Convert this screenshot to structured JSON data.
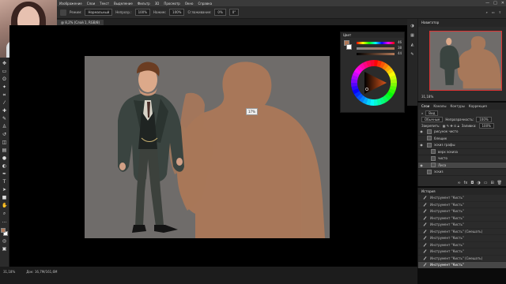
{
  "menubar": {
    "items": [
      "Изображение",
      "Слои",
      "Текст",
      "Выделение",
      "Фильтр",
      "3D",
      "Просмотр",
      "Окно",
      "Справка"
    ],
    "controls": [
      "—",
      "□",
      "✕"
    ]
  },
  "options": {
    "mode_label": "Режим:",
    "mode_value": "Нормальный",
    "opacity_label": "Непрозр.:",
    "opacity_value": "100%",
    "pressure_label": "Нажим:",
    "pressure_value": "100%",
    "smoothing_label": "Сглаживание:",
    "smoothing_value": "0%",
    "angle_value": "0°"
  },
  "document": {
    "tab_label": "@ 8,2% (Слой 1, RGB/8)",
    "cursor_tip": "17%"
  },
  "color_panel": {
    "title": "Цвет",
    "slider_values": [
      "46",
      "38",
      "44"
    ]
  },
  "navigator": {
    "title": "Навигатор",
    "zoom": "31,18%"
  },
  "layers": {
    "tabs": [
      "Слои",
      "Каналы",
      "Контуры",
      "Коррекция"
    ],
    "active_tab": "Слои",
    "filter_label": "Вид",
    "blend_mode": "Обычные",
    "opacity_label": "Непрозрачность:",
    "opacity_value": "100%",
    "lock_label": "Закрепить:",
    "fill_label": "Заливка:",
    "fill_value": "100%",
    "items": [
      {
        "name": "рисунок чисто",
        "visible": true,
        "selected": false,
        "indent": false
      },
      {
        "name": "блещик",
        "visible": false,
        "selected": false,
        "indent": false
      },
      {
        "name": "эскиз графы",
        "visible": true,
        "selected": false,
        "indent": false
      },
      {
        "name": "верх эскиза",
        "visible": false,
        "selected": false,
        "indent": true
      },
      {
        "name": "чисто",
        "visible": false,
        "selected": false,
        "indent": true
      },
      {
        "name": "Лиса",
        "visible": true,
        "selected": true,
        "indent": true
      },
      {
        "name": "эскиз",
        "visible": false,
        "selected": false,
        "indent": false
      }
    ]
  },
  "history": {
    "title": "История",
    "items": [
      "Инструмент \"Кисть\"",
      "Инструмент \"Кисть\"",
      "Инструмент \"Кисть\"",
      "Инструмент \"Кисть\"",
      "Инструмент \"Кисть\"",
      "Инструмент \"Кисть\" (Смешать)",
      "Инструмент \"Кисть\"",
      "Инструмент \"Кисть\"",
      "Инструмент \"Кисть\"",
      "Инструмент \"Кисть\" (Смешать)",
      "Инструмент \"Кисть\""
    ],
    "selected_index": 10
  },
  "status": {
    "zoom": "31,18%",
    "doc": "Док: 16,7M/161,6M"
  },
  "colors": {
    "foreground": "#b07858",
    "background": "#ffffff",
    "canvas_bg": "#6f6c6a",
    "sketch": "#b27a57"
  }
}
